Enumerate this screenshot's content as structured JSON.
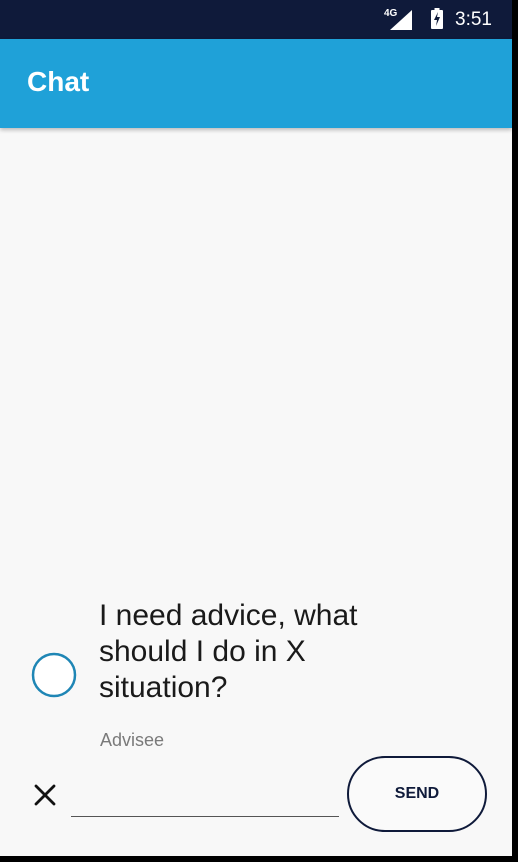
{
  "status_bar": {
    "network": "4G",
    "time": "3:51"
  },
  "app_bar": {
    "title": "Chat"
  },
  "message": {
    "text": "I need advice, what should I do in X situation?",
    "sender": "Advisee"
  },
  "composer": {
    "input_value": "",
    "input_placeholder": "",
    "send_label": "SEND"
  },
  "colors": {
    "status_bar": "#0f1a3a",
    "app_bar": "#1fa1d8",
    "background": "#f8f8f8",
    "avatar_ring": "#1f86b5"
  },
  "icons": {
    "network": "cell-signal-icon",
    "battery": "battery-charging-icon",
    "avatar": "avatar-circle-icon",
    "close": "close-icon"
  }
}
